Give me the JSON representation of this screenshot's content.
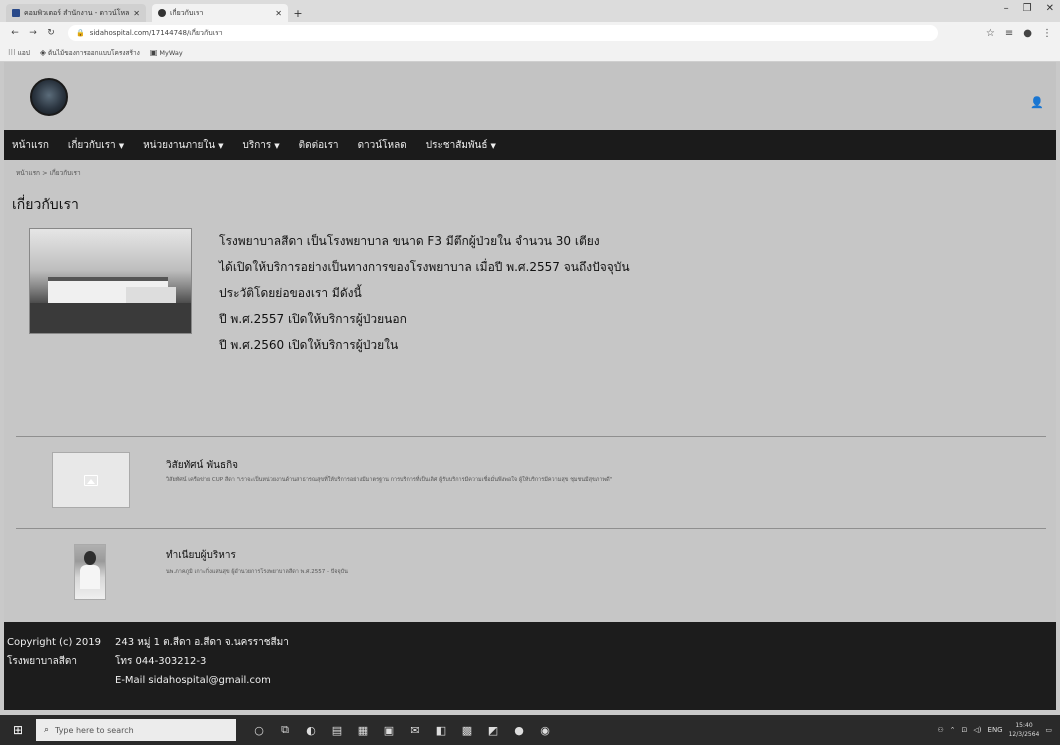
{
  "browser": {
    "tabs": [
      {
        "title": "คอมพิวเตอร์ สำนักงาน - ดาวน์โหลด",
        "active": false
      },
      {
        "title": "เกี่ยวกับเรา",
        "active": true
      }
    ],
    "new_tab_label": "+",
    "window_controls": [
      "–",
      "❐",
      "✕"
    ],
    "url": "sidahospital.com/17144748/เกี่ยวกับเรา",
    "bookmarks": [
      "แอป",
      "ต้นไม้ของการออกแบบโครงสร้าง",
      "MyWay"
    ]
  },
  "site": {
    "nav": [
      {
        "label": "หน้าแรก",
        "dropdown": false
      },
      {
        "label": "เกี่ยวกับเรา",
        "dropdown": true
      },
      {
        "label": "หน่วยงานภายใน",
        "dropdown": true
      },
      {
        "label": "บริการ",
        "dropdown": true
      },
      {
        "label": "ติดต่อเรา",
        "dropdown": false
      },
      {
        "label": "ดาวน์โหลด",
        "dropdown": false
      },
      {
        "label": "ประชาสัมพันธ์",
        "dropdown": true
      }
    ],
    "breadcrumb": {
      "home": "หน้าแรก",
      "sep": ">",
      "current": "เกี่ยวกับเรา"
    },
    "page_title": "เกี่ยวกับเรา",
    "about_lines": [
      "โรงพยาบาลสีดา เป็นโรงพยาบาล ขนาด F3  มีตึกผู้ป่วยใน จำนวน 30 เตียง",
      "ได้เปิดให้บริการอย่างเป็นทางการของโรงพยาบาล เมื่อปี พ.ศ.2557 จนถึงปัจจุบัน",
      "ประวัติโดยย่อของเรา มีดังนี้",
      "ปี พ.ศ.2557 เปิดให้บริการผู้ป่วยนอก",
      "ปี พ.ศ.2560 เปิดให้บริการผู้ป่วยใน"
    ],
    "sections": [
      {
        "title": "วิสัยทัศน์ พันธกิจ",
        "text": "วิสัยทัศน์ เครือข่าย CUP สีดา \"เราจะเป็นหน่วยงานด้านสาธารณสุขที่ให้บริการอย่างมีมาตรฐาน การบริการที่เป็นเลิศ ผู้รับบริการมีความเชื่อมั่นพึงพอใจ ผู้ให้บริการมีความสุข ชุมชนมีสุขภาพดี\""
      },
      {
        "title": "ทำเนียบผู้บริหาร",
        "text": "นพ.ภาคภูมิ เกาะกิ่งแสนสุข ผู้อำนวยการโรงพยาบาลสีดา พ.ศ.2557 - ปัจจุบัน"
      }
    ],
    "footer": {
      "copyright_line1": "Copyright (c) 2019",
      "copyright_line2": "โรงพยาบาลสีดา",
      "address": "243 หมู่ 1 ต.สีดา อ.สีดา จ.นครราชสีมา",
      "phone": "โทร 044-303212-3",
      "email": "E-Mail sidahospital@gmail.com"
    }
  },
  "taskbar": {
    "search_placeholder": "Type here to search",
    "tray_lang": "ENG",
    "time": "15:40",
    "date": "12/3/2564"
  }
}
